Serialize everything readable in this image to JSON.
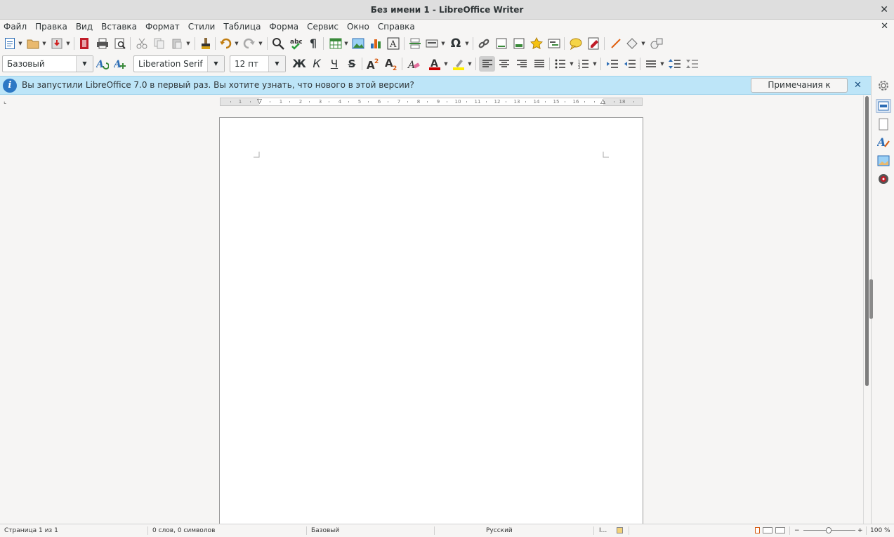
{
  "window": {
    "title": "Без имени 1 - LibreOffice Writer"
  },
  "menu": {
    "items": [
      "Файл",
      "Правка",
      "Вид",
      "Вставка",
      "Формат",
      "Стили",
      "Таблица",
      "Форма",
      "Сервис",
      "Окно",
      "Справка"
    ]
  },
  "toolbar2": {
    "paragraph_style": "Базовый",
    "font_name": "Liberation Serif",
    "font_size": "12 пт",
    "bold_label": "Ж",
    "italic_label": "К",
    "underline_label": "Ч",
    "strike_label": "S"
  },
  "infobar": {
    "message": "Вы запустили LibreOffice 7.0 в первый раз. Вы хотите узнать, что нового в этой версии?",
    "button_label": "Примечания к выпуску"
  },
  "ruler": {
    "numbers": [
      "1",
      "1",
      "2",
      "3",
      "4",
      "5",
      "6",
      "7",
      "8",
      "9",
      "10",
      "11",
      "12",
      "13",
      "14",
      "15",
      "16",
      "18"
    ]
  },
  "statusbar": {
    "page": "Страница 1 из 1",
    "words": "0 слов, 0 символов",
    "page_style": "Базовый",
    "language": "Русский",
    "insert_mode": "I...",
    "zoom": "100 %",
    "zoom_percent": 100
  },
  "colors": {
    "infobar_bg": "#bde5f8",
    "font_color": "#cc0000",
    "highlight_color": "#ffee00",
    "accent": "#2d78c5"
  },
  "icons": {
    "toolbar1": [
      "new-document-icon",
      "open-icon",
      "save-icon",
      "export-pdf-icon",
      "print-icon",
      "print-preview-icon",
      "cut-icon",
      "copy-icon",
      "paste-icon",
      "clone-formatting-icon",
      "undo-icon",
      "redo-icon",
      "find-replace-icon",
      "spellcheck-icon",
      "formatting-marks-icon",
      "insert-table-icon",
      "insert-image-icon",
      "insert-chart-icon",
      "insert-textbox-icon",
      "page-break-icon",
      "insert-field-icon",
      "special-character-icon",
      "hyperlink-icon",
      "footnote-icon",
      "endnote-icon",
      "bookmark-icon",
      "cross-reference-icon",
      "comment-icon",
      "track-changes-icon",
      "line-icon",
      "basic-shapes-icon",
      "draw-functions-icon"
    ],
    "sidebar": [
      "sidebar-settings-icon",
      "properties-icon",
      "page-icon",
      "styles-icon",
      "gallery-icon",
      "navigator-icon"
    ]
  }
}
